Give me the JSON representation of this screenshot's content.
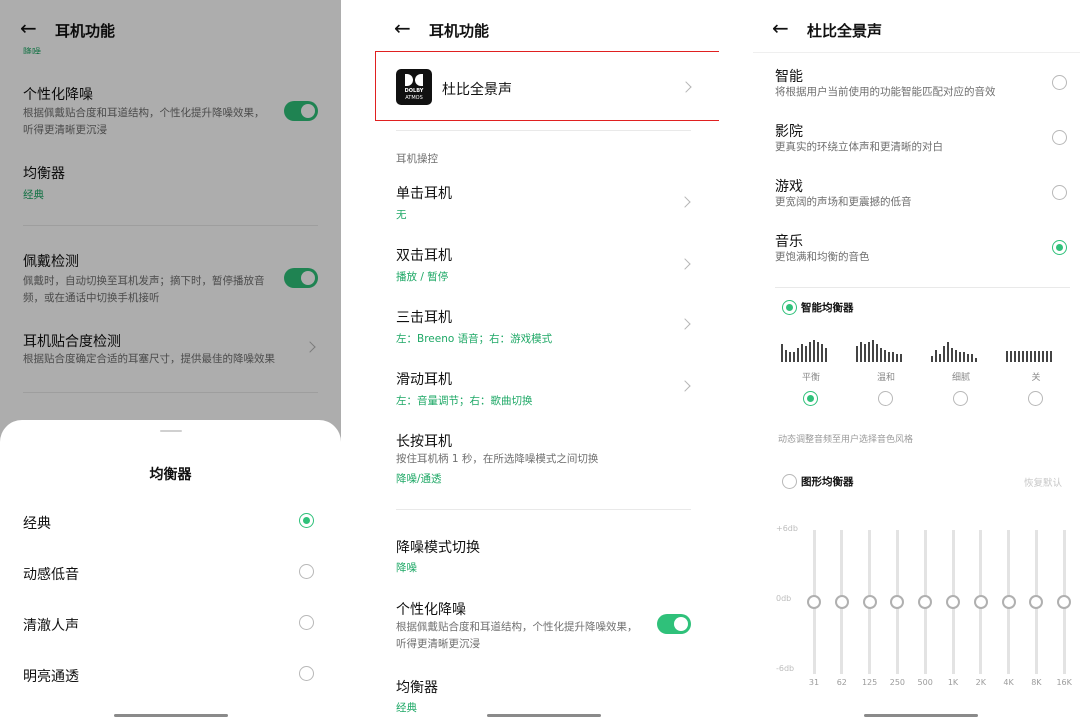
{
  "colors": {
    "accent": "#2fc17a",
    "green_text": "#1ea866",
    "highlight_border": "#e02020"
  },
  "left": {
    "header": {
      "back_icon": "arrow-left",
      "title": "耳机功能"
    },
    "cut_label": "降噪",
    "rows": [
      {
        "title": "个性化降噪",
        "sub": "根据佩戴贴合度和耳道结构，个性化提升降噪效果，听得更清晰更沉浸",
        "toggle": true
      },
      {
        "title": "均衡器",
        "value": "经典"
      },
      {
        "title": "佩戴检测",
        "sub": "佩戴时，自动切换至耳机发声；摘下时，暂停播放音频，或在通话中切换手机接听",
        "toggle": true
      },
      {
        "title": "耳机贴合度检测",
        "sub": "根据贴合度确定合适的耳塞尺寸，提供最佳的降噪效果"
      }
    ],
    "sheet": {
      "title": "均衡器",
      "options": [
        {
          "label": "经典",
          "selected": true
        },
        {
          "label": "动感低音",
          "selected": false
        },
        {
          "label": "清澈人声",
          "selected": false
        },
        {
          "label": "明亮通透",
          "selected": false
        }
      ]
    }
  },
  "middle": {
    "header": {
      "back_icon": "arrow-left",
      "title": "耳机功能"
    },
    "dolby": {
      "logo_line1": "DOLBY",
      "logo_line2": "ATMOS",
      "label": "杜比全景声"
    },
    "section_label": "耳机操控",
    "controls": [
      {
        "title": "单击耳机",
        "value": "无"
      },
      {
        "title": "双击耳机",
        "value": "播放 / 暂停"
      },
      {
        "title": "三击耳机",
        "value": "左：Breeno 语音；右：游戏模式"
      },
      {
        "title": "滑动耳机",
        "value": "左：音量调节；右：歌曲切换"
      },
      {
        "title": "长按耳机",
        "sub": "按住耳机柄 1 秒，在所选降噪模式之间切换",
        "value": "降噪/通透"
      }
    ],
    "more": [
      {
        "title": "降噪模式切换",
        "value": "降噪"
      },
      {
        "title": "个性化降噪",
        "sub": "根据佩戴贴合度和耳道结构，个性化提升降噪效果，听得更清晰更沉浸",
        "toggle": true
      },
      {
        "title": "均衡器",
        "value": "经典"
      }
    ]
  },
  "right": {
    "header": {
      "back_icon": "arrow-left",
      "title": "杜比全景声"
    },
    "modes": [
      {
        "title": "智能",
        "sub": "将根据用户当前使用的功能智能匹配对应的音效",
        "selected": false
      },
      {
        "title": "影院",
        "sub": "更真实的环绕立体声和更清晰的对白",
        "selected": false
      },
      {
        "title": "游戏",
        "sub": "更宽阔的声场和更震撼的低音",
        "selected": false
      },
      {
        "title": "音乐",
        "sub": "更饱满和均衡的音色",
        "selected": true
      }
    ],
    "smart_eq": {
      "label": "智能均衡器",
      "selected": true,
      "presets": [
        {
          "label": "平衡",
          "selected": true
        },
        {
          "label": "温和",
          "selected": false
        },
        {
          "label": "细腻",
          "selected": false
        },
        {
          "label": "关",
          "selected": false
        }
      ],
      "note": "动态调整音频至用户选择音色风格"
    },
    "graphic_eq": {
      "label": "图形均衡器",
      "selected": false,
      "reset": "恢复默认",
      "axis": [
        "+6db",
        "0db",
        "-6db"
      ],
      "bands": [
        "31",
        "62",
        "125",
        "250",
        "500",
        "1K",
        "2K",
        "4K",
        "8K",
        "16K"
      ],
      "gains_db": [
        0,
        0,
        0,
        0,
        0,
        0,
        0,
        0,
        0,
        0
      ]
    }
  }
}
